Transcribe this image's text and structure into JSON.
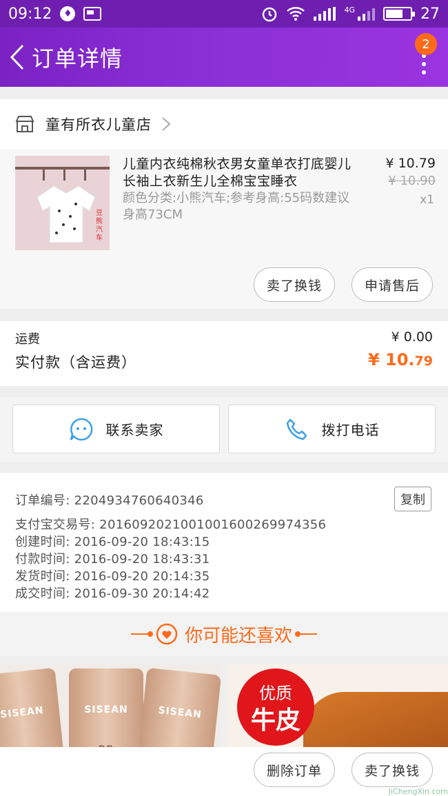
{
  "status_bar": {
    "time": "09:12",
    "network": "4G",
    "battery": "27"
  },
  "nav": {
    "title": "订单详情",
    "badge_count": "2"
  },
  "shop": {
    "name": "童有所衣儿童店"
  },
  "item": {
    "title": "儿童内衣纯棉秋衣男女童单衣打底婴儿长袖上衣新生儿全棉宝宝睡衣",
    "sku": "颜色分类:小熊汽车;参考身高:55码数建议身高73CM",
    "price": "¥ 10.79",
    "original_price": "¥ 10.90",
    "quantity": "x1",
    "image_text": "豆熊汽车",
    "buttons": {
      "sell": "卖了换钱",
      "after_sale": "申请售后"
    }
  },
  "fees": {
    "shipping_label": "运费",
    "shipping_value": "¥ 0.00",
    "paid_label": "实付款（含运费）",
    "paid_currency": "¥ ",
    "paid_int": "10.",
    "paid_dec": "79"
  },
  "contact": {
    "seller": "联系卖家",
    "phone": "拨打电话"
  },
  "order_info": {
    "copy": "复制",
    "lines": [
      "订单编号: 2204934760640346",
      "支付宝交易号: 2016092021001001600269974356",
      "创建时间: 2016-09-20 18:43:15",
      "付款时间: 2016-09-20 18:43:31",
      "发货时间: 2016-09-20 20:14:35",
      "成交时间: 2016-09-30 20:14:42"
    ]
  },
  "recommend": {
    "title": "你可能还喜欢"
  },
  "products": {
    "p1_brand": "SISEAN",
    "p1_label": "BB",
    "p2_line1": "优质",
    "p2_line2": "牛皮"
  },
  "bottom": {
    "delete": "删除订单",
    "sell": "卖了换钱"
  },
  "watermark": "JiChengXin.com",
  "colors": {
    "primary": "#7b22c4",
    "accent": "#ff6a1a"
  }
}
